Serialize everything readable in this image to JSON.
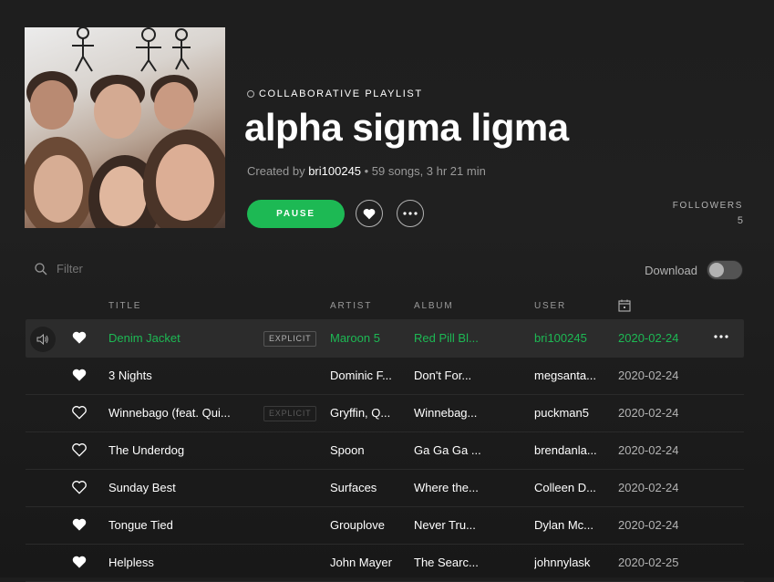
{
  "playlist": {
    "type_label": "COLLABORATIVE PLAYLIST",
    "title": "alpha sigma ligma",
    "created_by_prefix": "Created by ",
    "owner": "bri100245",
    "stats": " • 59 songs, 3 hr 21 min",
    "pause_label": "PAUSE",
    "followers_label": "FOLLOWERS",
    "followers_count": "5"
  },
  "filter": {
    "placeholder": "Filter"
  },
  "download": {
    "label": "Download",
    "enabled": false
  },
  "columns": {
    "title": "TITLE",
    "artist": "ARTIST",
    "album": "ALBUM",
    "user": "USER"
  },
  "explicit_label": "EXPLICIT",
  "tracks": [
    {
      "title": "Denim Jacket",
      "artist": "Maroon 5",
      "album": "Red Pill Bl...",
      "user": "bri100245",
      "date": "2020-02-24",
      "liked": true,
      "explicit": true,
      "playing": true
    },
    {
      "title": "3 Nights",
      "artist": "Dominic F...",
      "album": "Don't For...",
      "user": "megsanta...",
      "date": "2020-02-24",
      "liked": true,
      "explicit": false,
      "playing": false
    },
    {
      "title": "Winnebago (feat. Qui...",
      "artist": "Gryffin, Q...",
      "album": "Winnebag...",
      "user": "puckman5",
      "date": "2020-02-24",
      "liked": false,
      "explicit": true,
      "playing": false
    },
    {
      "title": "The Underdog",
      "artist": "Spoon",
      "album": "Ga Ga Ga ...",
      "user": "brendanla...",
      "date": "2020-02-24",
      "liked": false,
      "explicit": false,
      "playing": false
    },
    {
      "title": "Sunday Best",
      "artist": "Surfaces",
      "album": "Where the...",
      "user": "Colleen D...",
      "date": "2020-02-24",
      "liked": false,
      "explicit": false,
      "playing": false
    },
    {
      "title": "Tongue Tied",
      "artist": "Grouplove",
      "album": "Never Tru...",
      "user": "Dylan Mc...",
      "date": "2020-02-24",
      "liked": true,
      "explicit": false,
      "playing": false
    },
    {
      "title": "Helpless",
      "artist": "John Mayer",
      "album": "The Searc...",
      "user": "johnnylask",
      "date": "2020-02-25",
      "liked": true,
      "explicit": false,
      "playing": false
    }
  ],
  "colors": {
    "accent": "#1db954",
    "background": "#181818",
    "text": "#ffffff",
    "muted": "#b3b3b3"
  },
  "icons": [
    "speaker-icon",
    "heart-icon",
    "more-icon",
    "search-icon",
    "calendar-icon"
  ]
}
